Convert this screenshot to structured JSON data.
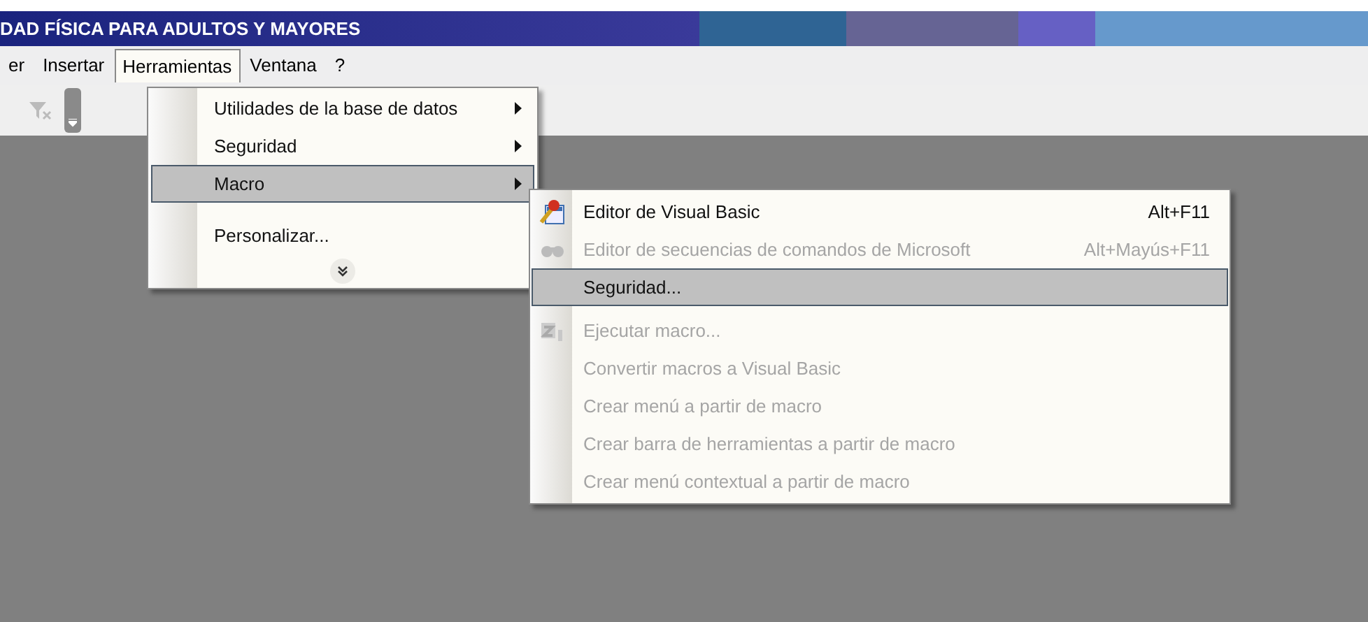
{
  "window": {
    "title": "DAD FÍSICA PARA ADULTOS Y MAYORES"
  },
  "menu_bar": [
    {
      "label": "er",
      "selected": false
    },
    {
      "label": "Insertar",
      "selected": false
    },
    {
      "label": "Herramientas",
      "selected": true
    },
    {
      "label": "Ventana",
      "selected": false
    },
    {
      "label": "?",
      "selected": false
    }
  ],
  "tools_menu": {
    "items": [
      {
        "label": "Utilidades de la base de datos",
        "submenu": true,
        "selected": false
      },
      {
        "label": "Seguridad",
        "submenu": true,
        "selected": false
      },
      {
        "label": "Macro",
        "submenu": true,
        "selected": true
      },
      {
        "label": "Personalizar...",
        "submenu": false,
        "selected": false
      }
    ]
  },
  "macro_menu": {
    "items": [
      {
        "label": "Editor de Visual Basic",
        "shortcut": "Alt+F11",
        "kind": "editor",
        "disabled": false,
        "selected": false
      },
      {
        "label": "Editor de secuencias de comandos de Microsoft",
        "shortcut": "Alt+Mayús+F11",
        "kind": "script",
        "disabled": true,
        "selected": false
      },
      {
        "label": "Seguridad...",
        "disabled": false,
        "selected": true
      },
      {
        "label": "Ejecutar macro...",
        "kind": "run",
        "disabled": true,
        "selected": false
      },
      {
        "label": "Convertir macros a Visual Basic",
        "disabled": true,
        "selected": false
      },
      {
        "label": "Crear menú a partir de macro",
        "disabled": true,
        "selected": false
      },
      {
        "label": "Crear barra de herramientas a partir de macro",
        "disabled": true,
        "selected": false
      },
      {
        "label": "Crear menú contextual a partir de macro",
        "disabled": true,
        "selected": false
      }
    ]
  }
}
